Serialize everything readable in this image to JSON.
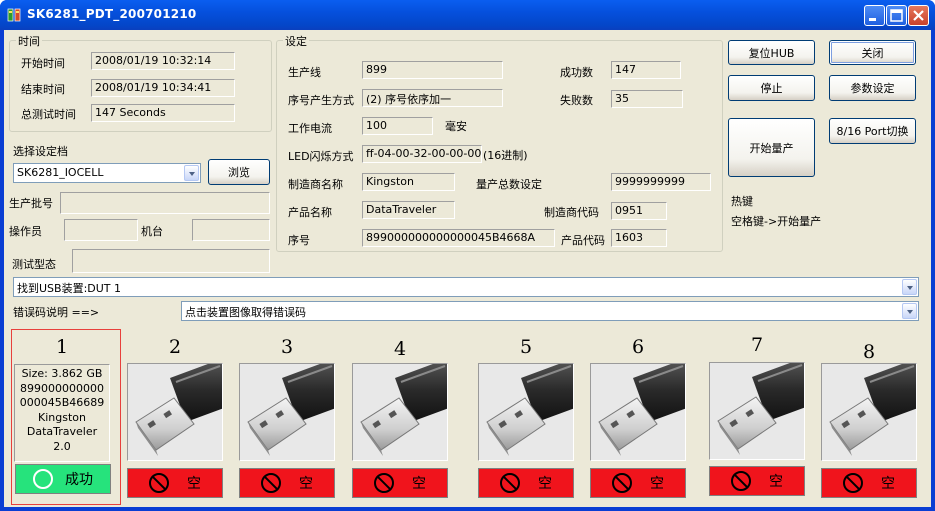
{
  "window": {
    "title": "SK6281_PDT_200701210"
  },
  "time_group": {
    "caption": "时间",
    "start_label": "开始时间",
    "start_value": "2008/01/19 10:32:14",
    "end_label": "结束时间",
    "end_value": "2008/01/19 10:34:41",
    "total_label": "总测试时间",
    "total_value": "147 Seconds"
  },
  "profile": {
    "label": "选择设定档",
    "value": "SK6281_IOCELL",
    "browse": "浏览"
  },
  "production": {
    "batch_label": "生产批号",
    "operator_label": "操作员",
    "machine_label": "机台",
    "test_model_label": "测试型态"
  },
  "settings": {
    "caption": "设定",
    "line_label": "生产线",
    "line_value": "899",
    "serial_mode_label": "序号产生方式",
    "serial_mode_value": "(2) 序号依序加一",
    "current_label": "工作电流",
    "current_value": "100",
    "current_unit": "毫安",
    "led_label": "LED闪烁方式",
    "led_value": "ff-04-00-32-00-00-00",
    "led_note": "(16进制)",
    "vendor_label": "制造商名称",
    "vendor_value": "Kingston",
    "total_qty_label": "量产总数设定",
    "total_qty_value": "9999999999",
    "product_label": "产品名称",
    "product_value": "DataTraveler",
    "vendor_code_label": "制造商代码",
    "vendor_code_value": "0951",
    "serial_label": "序号",
    "serial_value": "899000000000000045B4668A",
    "product_code_label": "产品代码",
    "product_code_value": "1603",
    "success_label": "成功数",
    "success_value": "147",
    "fail_label": "失败数",
    "fail_value": "35"
  },
  "buttons": {
    "reset_hub": "复位HUB",
    "close": "关闭",
    "stop": "停止",
    "params": "参数设定",
    "start": "开始量产",
    "port_switch": "8/16 Port切换"
  },
  "hotkey": {
    "title": "热键",
    "desc": "空格键->开始量产"
  },
  "status_combo": {
    "value": "找到USB装置:DUT 1"
  },
  "error": {
    "label": "错误码说明 ==>",
    "value": "点击装置图像取得错误码"
  },
  "slots": [
    {
      "num": "1",
      "info": [
        "Size: 3.862 GB",
        "899000000000",
        "000045B46689",
        "Kingston",
        "DataTraveler",
        "2.0"
      ],
      "state": "成功",
      "status": "success"
    },
    {
      "num": "2",
      "state": "空",
      "status": "empty"
    },
    {
      "num": "3",
      "state": "空",
      "status": "empty"
    },
    {
      "num": "4",
      "state": "空",
      "status": "empty"
    },
    {
      "num": "5",
      "state": "空",
      "status": "empty"
    },
    {
      "num": "6",
      "state": "空",
      "status": "empty"
    },
    {
      "num": "7",
      "state": "空",
      "status": "empty"
    },
    {
      "num": "8",
      "state": "空",
      "status": "empty"
    }
  ],
  "colors": {
    "title_bar": "#0550dd",
    "dialog_bg": "#ece9d8",
    "empty_state": "#f0141c",
    "success_state": "#26e37c",
    "active_slot_border": "#e8403c"
  }
}
